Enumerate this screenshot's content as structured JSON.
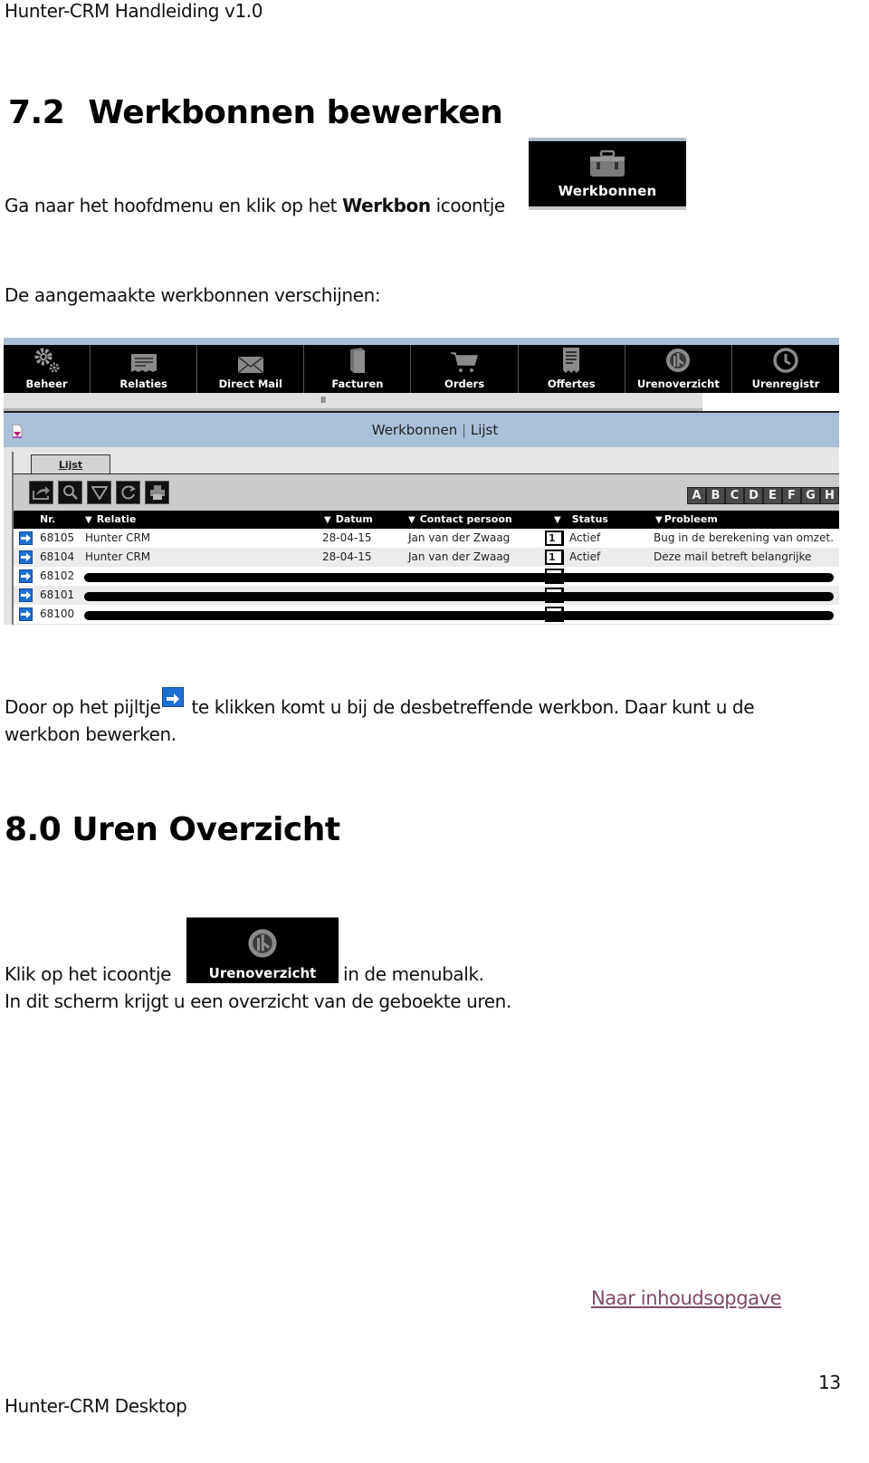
{
  "header": {
    "running_title": "Hunter-CRM Handleiding v1.0"
  },
  "section_72": {
    "number": "7.2",
    "title": "Werkbonnen bewerken",
    "p1_before": "Ga naar het hoofdmenu en klik op het ",
    "p1_bold": "Werkbon",
    "p1_after": " icoontje",
    "werkbonnen_tile": {
      "label": "Werkbonnen",
      "icon": "toolbox-icon"
    },
    "p2": "De aangemaakte werkbonnen verschijnen:",
    "p3_before": "Door op het pijltje",
    "p3_after": "te klikken komt u bij de desbetreffende werkbon. Daar kunt u de werkbon bewerken."
  },
  "app": {
    "menu": [
      {
        "label": "Beheer",
        "icon": "gears-icon"
      },
      {
        "label": "Relaties",
        "icon": "address-card-icon"
      },
      {
        "label": "Direct Mail",
        "icon": "envelope-icon"
      },
      {
        "label": "Facturen",
        "icon": "book-icon"
      },
      {
        "label": "Orders",
        "icon": "cart-icon"
      },
      {
        "label": "Offertes",
        "icon": "receipt-icon"
      },
      {
        "label": "Urenoverzicht",
        "icon": "clock-chart-icon"
      },
      {
        "label": "Urenregistr",
        "icon": "clock-icon"
      }
    ],
    "grip": "III",
    "window_title": "Werkbonnen",
    "window_sep": "|",
    "window_sub": "Lijst",
    "tab_label": "Lijst",
    "toolbar_buttons": [
      "export-icon",
      "search-icon",
      "filter-icon",
      "refresh-icon",
      "print-icon"
    ],
    "alphabet": [
      "A",
      "B",
      "C",
      "D",
      "E",
      "F",
      "G",
      "H"
    ],
    "columns": {
      "nr": "Nr.",
      "relatie": "Relatie",
      "datum": "Datum",
      "contact": "Contact persoon",
      "status": "Status",
      "probleem": "Probleem"
    },
    "rows": [
      {
        "nr": "68105",
        "relatie": "Hunter CRM",
        "datum": "28-04-15",
        "contact": "Jan van der Zwaag",
        "prio": "1",
        "status": "Actief",
        "probleem": "Bug in de berekening van omzet.",
        "redacted": false
      },
      {
        "nr": "68104",
        "relatie": "Hunter CRM",
        "datum": "28-04-15",
        "contact": "Jan van der Zwaag",
        "prio": "1",
        "status": "Actief",
        "probleem": "Deze mail betreft belangrijke",
        "redacted": false
      },
      {
        "nr": "68102",
        "relatie": "",
        "datum": "",
        "contact": "",
        "prio": "",
        "status": "",
        "probleem": "",
        "redacted": true
      },
      {
        "nr": "68101",
        "relatie": "",
        "datum": "",
        "contact": "",
        "prio": "",
        "status": "",
        "probleem": "",
        "redacted": true
      },
      {
        "nr": "68100",
        "relatie": "",
        "datum": "",
        "contact": "",
        "prio": "",
        "status": "",
        "probleem": "",
        "redacted": true
      }
    ]
  },
  "section_80": {
    "number": "8.0",
    "title": "Uren Overzicht",
    "p4_before": "Klik op het icoontje",
    "p4_after": "in de menubalk.",
    "uren_tile": {
      "label": "Urenoverzicht",
      "icon": "clock-chart-icon"
    },
    "p5": "In dit scherm krijgt u een overzicht van de geboekte uren."
  },
  "footer": {
    "toc_link": "Naar inhoudsopgave",
    "page_number": "13",
    "footer_text": "Hunter-CRM Desktop"
  },
  "colors": {
    "link": "#7e4b69",
    "arrow_blue": "#1d6fd1",
    "titlebar": "#aac0da",
    "menubar": "#000000"
  }
}
